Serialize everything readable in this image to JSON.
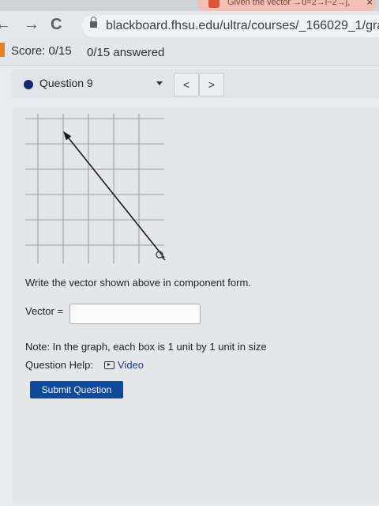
{
  "browser": {
    "tab_title": "Given the vector →u=2→i−2→j,",
    "tab_close": "×",
    "back": "←",
    "forward": "→",
    "reload": "C",
    "url": "blackboard.fhsu.edu/ultra/courses/_166029_1/grade"
  },
  "header": {
    "score": "Score: 0/15",
    "answered": "0/15 answered"
  },
  "question_nav": {
    "question_label": "Question 9",
    "prev": "<",
    "next": ">"
  },
  "graph": {
    "grid": "on",
    "vector": {
      "tail": [
        4,
        -5
      ],
      "head": [
        0,
        0
      ]
    },
    "colors": {
      "grid": "#9c9ea6",
      "vector": "#1a1a1a"
    }
  },
  "question": {
    "prompt": "Write the vector shown above in component form.",
    "vector_label": "Vector =",
    "vector_value": "",
    "note": "Note: In the graph, each box is 1 unit by 1 unit in size",
    "help_label": "Question Help:",
    "video_label": "Video",
    "submit_label": "Submit Question"
  },
  "colors": {
    "accent": "#0f4a98",
    "question_dot": "#152a70",
    "score_accent": "#e0832c"
  }
}
